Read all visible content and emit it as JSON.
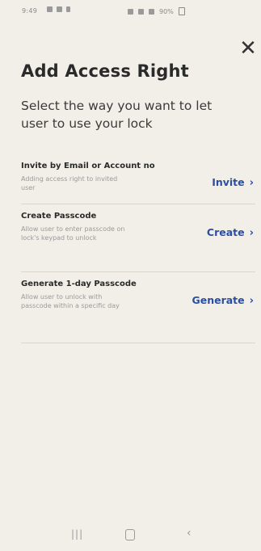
{
  "status_bar": {
    "time": "9:49",
    "battery": "90%"
  },
  "header": {
    "title": "Add Access Right",
    "subtitle": "Select the way you want to let user to use your lock",
    "close_icon": "close-icon"
  },
  "options": [
    {
      "title": "Invite by Email or Account no",
      "description": "Adding access right to invited user",
      "action": "Invite"
    },
    {
      "title": "Create Passcode",
      "description": "Allow user to enter passcode on lock's keypad to unlock",
      "action": "Create"
    },
    {
      "title": "Generate 1-day Passcode",
      "description": "Allow user to unlock with passcode within a specific day",
      "action": "Generate"
    }
  ],
  "nav_bar": {
    "icons": [
      "recents-icon",
      "home-icon",
      "back-icon"
    ]
  },
  "colors": {
    "background": "#f2efe9",
    "accent": "#2b4ea0",
    "text": "#2a2a2a",
    "muted": "#9a9a9a"
  }
}
